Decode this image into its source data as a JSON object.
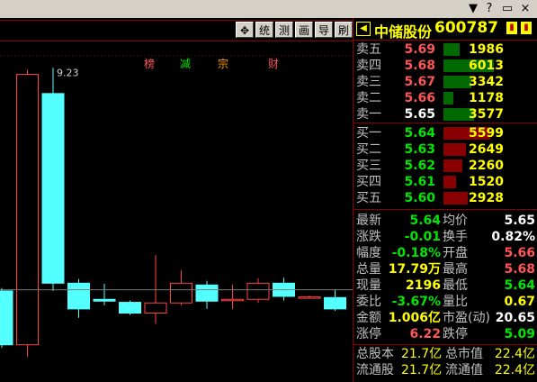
{
  "colors": {
    "up": "#ff4444",
    "down": "#54ffff",
    "grid": "#8a0000",
    "ask_bar": "#006a00",
    "bid_bar": "#8a0000",
    "stock_name": "#ffff00"
  },
  "window_controls": [
    "minimize-icon",
    "help-icon",
    "restore-icon",
    "close-icon"
  ],
  "toolbar": {
    "buttons": [
      {
        "icon": "move-icon",
        "label": "✥"
      },
      {
        "label": "统"
      },
      {
        "label": "测"
      },
      {
        "label": "画"
      },
      {
        "label": "导"
      },
      {
        "label": "刷"
      }
    ]
  },
  "chart": {
    "high_label": "9.23",
    "event_tags": [
      {
        "label": "榜",
        "color": "#ff5555"
      },
      {
        "label": "减",
        "color": "#00e600"
      },
      {
        "label": "宗",
        "color": "#ff9900"
      },
      {
        "label": "财",
        "color": "#ff5555"
      }
    ]
  },
  "chart_data": {
    "type": "candlestick",
    "high_label": "9.23",
    "candles": [
      {
        "open": 5.5,
        "close": 4.6,
        "high": 5.55,
        "low": 4.55,
        "dir": "down"
      },
      {
        "open": 4.6,
        "close": 9.12,
        "high": 9.2,
        "low": 4.4,
        "dir": "up"
      },
      {
        "open": 8.8,
        "close": 5.63,
        "high": 9.23,
        "low": 5.5,
        "dir": "down"
      },
      {
        "open": 5.63,
        "close": 5.2,
        "high": 5.7,
        "low": 5.05,
        "dir": "down"
      },
      {
        "open": 5.36,
        "close": 5.33,
        "high": 5.62,
        "low": 5.26,
        "dir": "down"
      },
      {
        "open": 5.31,
        "close": 5.13,
        "high": 5.34,
        "low": 5.1,
        "dir": "down"
      },
      {
        "open": 5.13,
        "close": 5.3,
        "high": 6.1,
        "low": 4.95,
        "dir": "up"
      },
      {
        "open": 5.3,
        "close": 5.63,
        "high": 5.85,
        "low": 5.26,
        "dir": "up"
      },
      {
        "open": 5.6,
        "close": 5.33,
        "high": 5.67,
        "low": 5.2,
        "dir": "down"
      },
      {
        "open": 5.34,
        "close": 5.36,
        "high": 5.6,
        "low": 5.2,
        "dir": "up"
      },
      {
        "open": 5.36,
        "close": 5.63,
        "high": 5.71,
        "low": 5.3,
        "dir": "up"
      },
      {
        "open": 5.63,
        "close": 5.41,
        "high": 5.72,
        "low": 5.34,
        "dir": "down"
      },
      {
        "open": 5.4,
        "close": 5.4,
        "high": 5.43,
        "low": 5.37,
        "dir": "up"
      },
      {
        "open": 5.39,
        "close": 5.2,
        "high": 5.52,
        "low": 5.17,
        "dir": "down"
      }
    ],
    "ref_price": 5.52,
    "y_range": [
      4.4,
      9.4
    ]
  },
  "quote": {
    "name": "中储股份",
    "code": "600787",
    "asks": [
      {
        "label": "卖五",
        "price": "5.69",
        "vol": "1986",
        "fill": 0.33
      },
      {
        "label": "卖四",
        "price": "5.68",
        "vol": "6013",
        "fill": 1.0
      },
      {
        "label": "卖三",
        "price": "5.67",
        "vol": "3342",
        "fill": 0.56
      },
      {
        "label": "卖二",
        "price": "5.66",
        "vol": "1178",
        "fill": 0.2
      },
      {
        "label": "卖一",
        "price": "5.65",
        "vol": "3577",
        "fill": 0.6
      }
    ],
    "bids": [
      {
        "label": "买一",
        "price": "5.64",
        "vol": "5599",
        "fill": 0.93
      },
      {
        "label": "买二",
        "price": "5.63",
        "vol": "2649",
        "fill": 0.44
      },
      {
        "label": "买三",
        "price": "5.62",
        "vol": "2260",
        "fill": 0.38
      },
      {
        "label": "买四",
        "price": "5.61",
        "vol": "1520",
        "fill": 0.25
      },
      {
        "label": "买五",
        "price": "5.60",
        "vol": "2928",
        "fill": 0.49
      }
    ],
    "stats": [
      {
        "l1": "最新",
        "v1": "5.64",
        "c1": "green",
        "l2": "均价",
        "v2": "5.65",
        "c2": "white"
      },
      {
        "l1": "涨跌",
        "v1": "-0.01",
        "c1": "green",
        "l2": "换手",
        "v2": "0.82%",
        "c2": "white"
      },
      {
        "l1": "幅度",
        "v1": "-0.18%",
        "c1": "green",
        "l2": "开盘",
        "v2": "5.66",
        "c2": "red"
      },
      {
        "l1": "总量",
        "v1": "17.79万",
        "c1": "yellow",
        "l2": "最高",
        "v2": "5.68",
        "c2": "red"
      },
      {
        "l1": "现量",
        "v1": "2196",
        "c1": "yellow",
        "l2": "最低",
        "v2": "5.64",
        "c2": "green"
      },
      {
        "l1": "委比",
        "v1": "-3.67%",
        "c1": "green",
        "l2": "量比",
        "v2": "0.67",
        "c2": "yellow"
      },
      {
        "l1": "金额",
        "v1": "1.006亿",
        "c1": "yellow",
        "l2": "市盈(动)",
        "v2": "20.65",
        "c2": "white"
      },
      {
        "l1": "涨停",
        "v1": "6.22",
        "c1": "red",
        "l2": "跌停",
        "v2": "5.09",
        "c2": "green"
      }
    ],
    "capital": [
      {
        "l1": "总股本",
        "v1": "21.7亿",
        "l2": "总市值",
        "v2": "22.4亿"
      },
      {
        "l1": "流通股",
        "v1": "21.7亿",
        "l2": "流通值",
        "v2": "22.4亿"
      }
    ]
  }
}
